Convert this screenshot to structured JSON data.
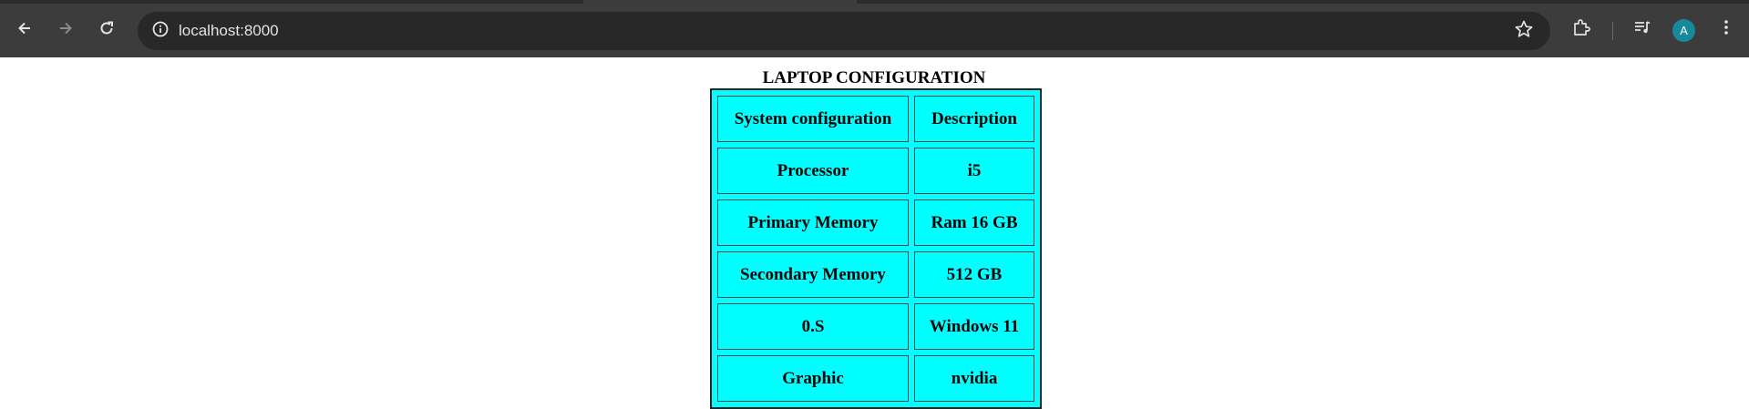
{
  "browser": {
    "url": "localhost:8000",
    "profile_initial": "A",
    "icons": {
      "back": "arrow-left-icon",
      "forward": "arrow-right-icon",
      "reload": "reload-icon",
      "site_info": "info-icon",
      "bookmark": "star-icon",
      "extensions": "puzzle-icon",
      "media": "media-queue-icon",
      "menu": "three-dots-icon"
    },
    "colors": {
      "toolbar": "#3c3c3c",
      "omnibox": "#282828",
      "avatar": "#18899a"
    }
  },
  "page": {
    "caption": "LAPTOP CONFIGURATION",
    "table_background": "#00ffff",
    "headers": [
      "System configuration",
      "Description"
    ],
    "rows": [
      [
        "Processor",
        "i5"
      ],
      [
        "Primary Memory",
        "Ram 16 GB"
      ],
      [
        "Secondary Memory",
        "512 GB"
      ],
      [
        "0.S",
        "Windows 11"
      ],
      [
        "Graphic",
        "nvidia"
      ]
    ]
  }
}
